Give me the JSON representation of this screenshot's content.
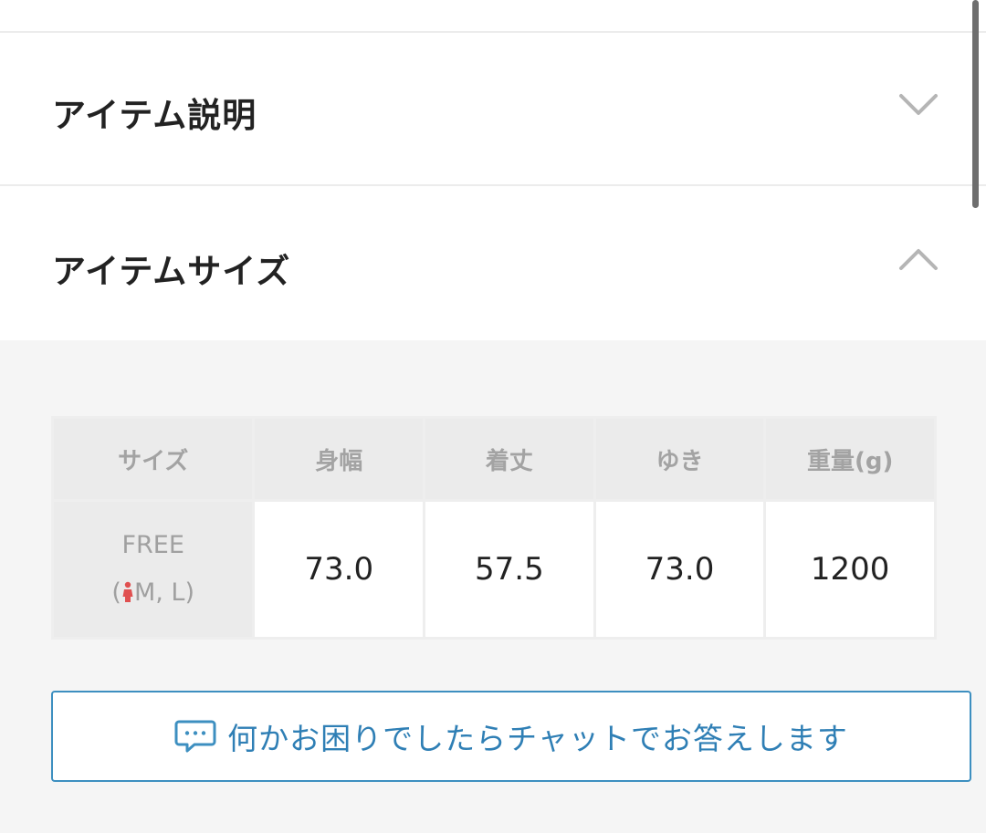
{
  "accordion": {
    "item_description": {
      "title": "アイテム説明",
      "icon": "chevron-down-icon",
      "expanded": false
    },
    "item_size": {
      "title": "アイテムサイズ",
      "icon": "chevron-up-icon",
      "expanded": true
    }
  },
  "size_table": {
    "headers": [
      "サイズ",
      "身幅",
      "着丈",
      "ゆき",
      "重量(g)"
    ],
    "rows": [
      {
        "size_name": "FREE",
        "size_sub_open": "(",
        "size_sub_icon": "person-icon",
        "size_sub_text": "M, L",
        "size_sub_close": ")",
        "values": [
          "73.0",
          "57.5",
          "73.0",
          "1200"
        ]
      }
    ]
  },
  "chat_button": {
    "icon": "chat-bubble-icon",
    "label": "何かお困りでしたらチャットでお答えします"
  },
  "colors": {
    "accent": "#3d8fc0",
    "person_icon": "#e05050",
    "panel_background": "#f5f5f5",
    "header_cell": "#ebebeb"
  }
}
